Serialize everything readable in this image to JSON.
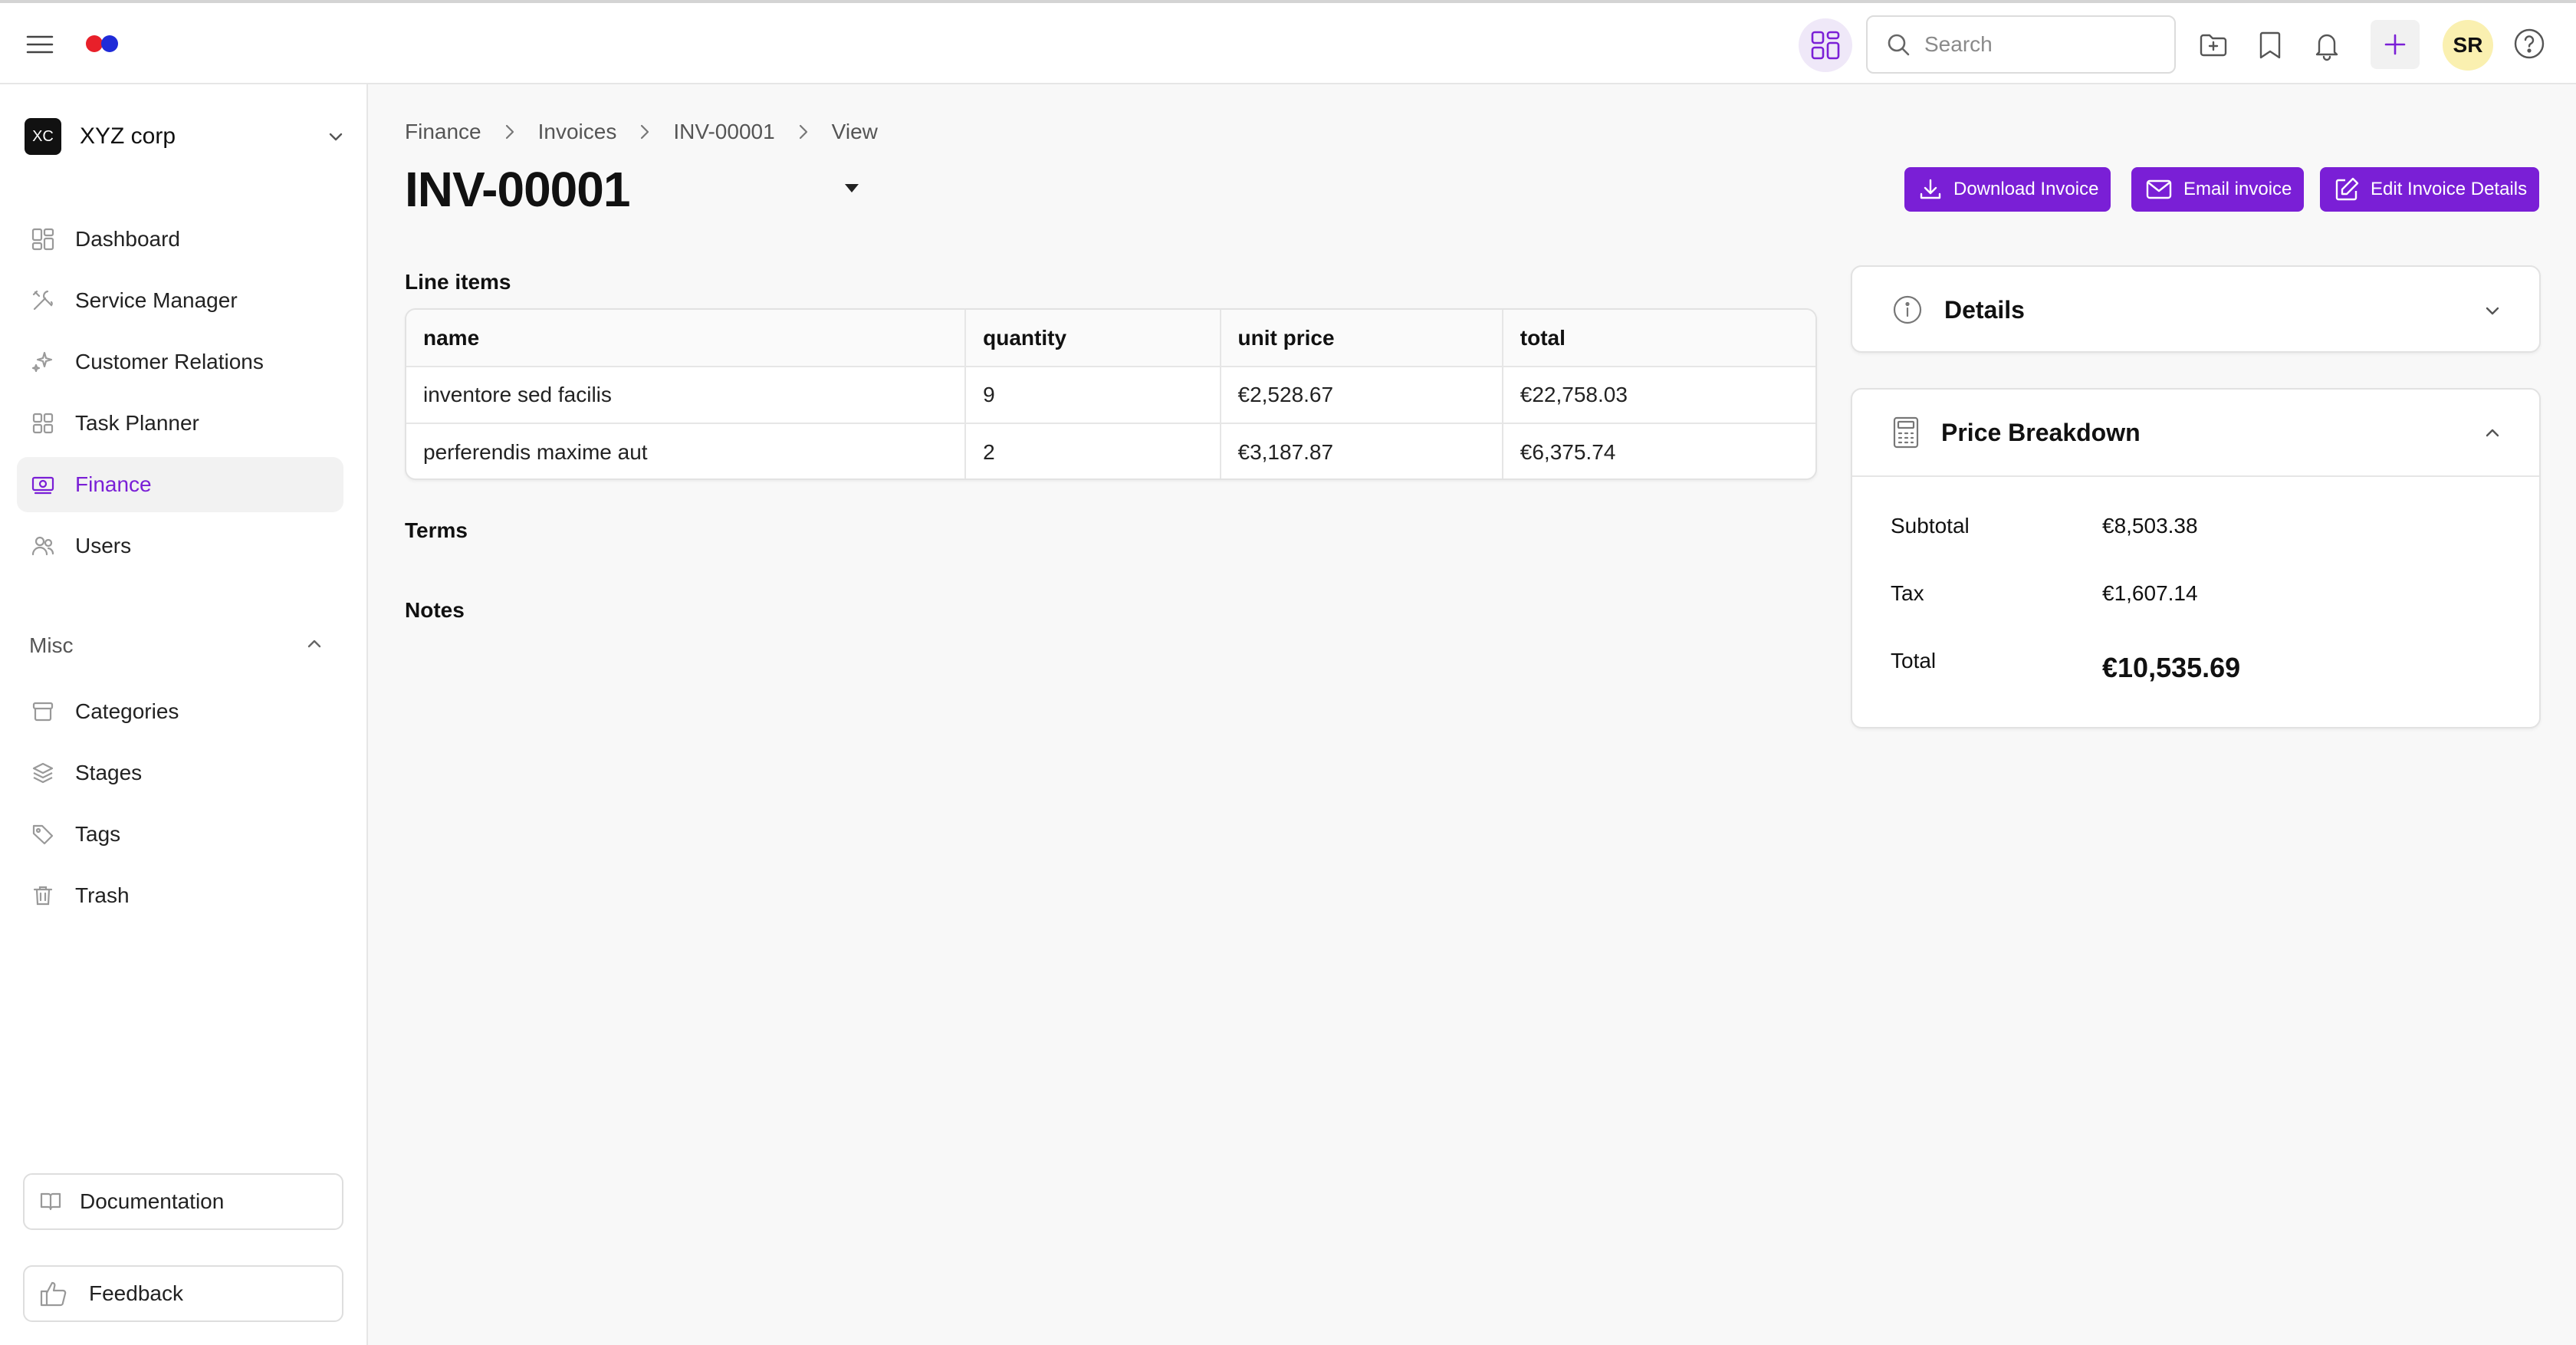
{
  "topbar": {
    "search_placeholder": "Search",
    "avatar_initials": "SR"
  },
  "sidebar": {
    "org": {
      "badge": "XC",
      "name": "XYZ corp"
    },
    "items": [
      {
        "label": "Dashboard",
        "icon": "dashboard-icon"
      },
      {
        "label": "Service Manager",
        "icon": "tools-icon"
      },
      {
        "label": "Customer Relations",
        "icon": "sparkles-icon"
      },
      {
        "label": "Task Planner",
        "icon": "grid-icon"
      },
      {
        "label": "Finance",
        "icon": "money-icon",
        "active": true
      },
      {
        "label": "Users",
        "icon": "users-icon"
      }
    ],
    "misc_label": "Misc",
    "misc_items": [
      {
        "label": "Categories",
        "icon": "archive-icon"
      },
      {
        "label": "Stages",
        "icon": "layers-icon"
      },
      {
        "label": "Tags",
        "icon": "tag-icon"
      },
      {
        "label": "Trash",
        "icon": "trash-icon"
      }
    ],
    "documentation_label": "Documentation",
    "feedback_label": "Feedback"
  },
  "breadcrumb": [
    "Finance",
    "Invoices",
    "INV-00001",
    "View"
  ],
  "page_title": "INV-00001",
  "actions": {
    "download": "Download Invoice",
    "email": "Email invoice",
    "edit": "Edit Invoice Details"
  },
  "line_items": {
    "heading": "Line items",
    "columns": [
      "name",
      "quantity",
      "unit price",
      "total"
    ],
    "rows": [
      [
        "inventore sed facilis",
        "9",
        "€2,528.67",
        "€22,758.03"
      ],
      [
        "perferendis maxime aut",
        "2",
        "€3,187.87",
        "€6,375.74"
      ]
    ]
  },
  "terms_heading": "Terms",
  "notes_heading": "Notes",
  "details_panel": {
    "title": "Details"
  },
  "price_breakdown": {
    "title": "Price Breakdown",
    "subtotal_label": "Subtotal",
    "subtotal_value": "€8,503.38",
    "tax_label": "Tax",
    "tax_value": "€1,607.14",
    "total_label": "Total",
    "total_value": "€10,535.69"
  },
  "colors": {
    "accent": "#7a1fd6",
    "avatar_bg": "#faf0b0"
  }
}
